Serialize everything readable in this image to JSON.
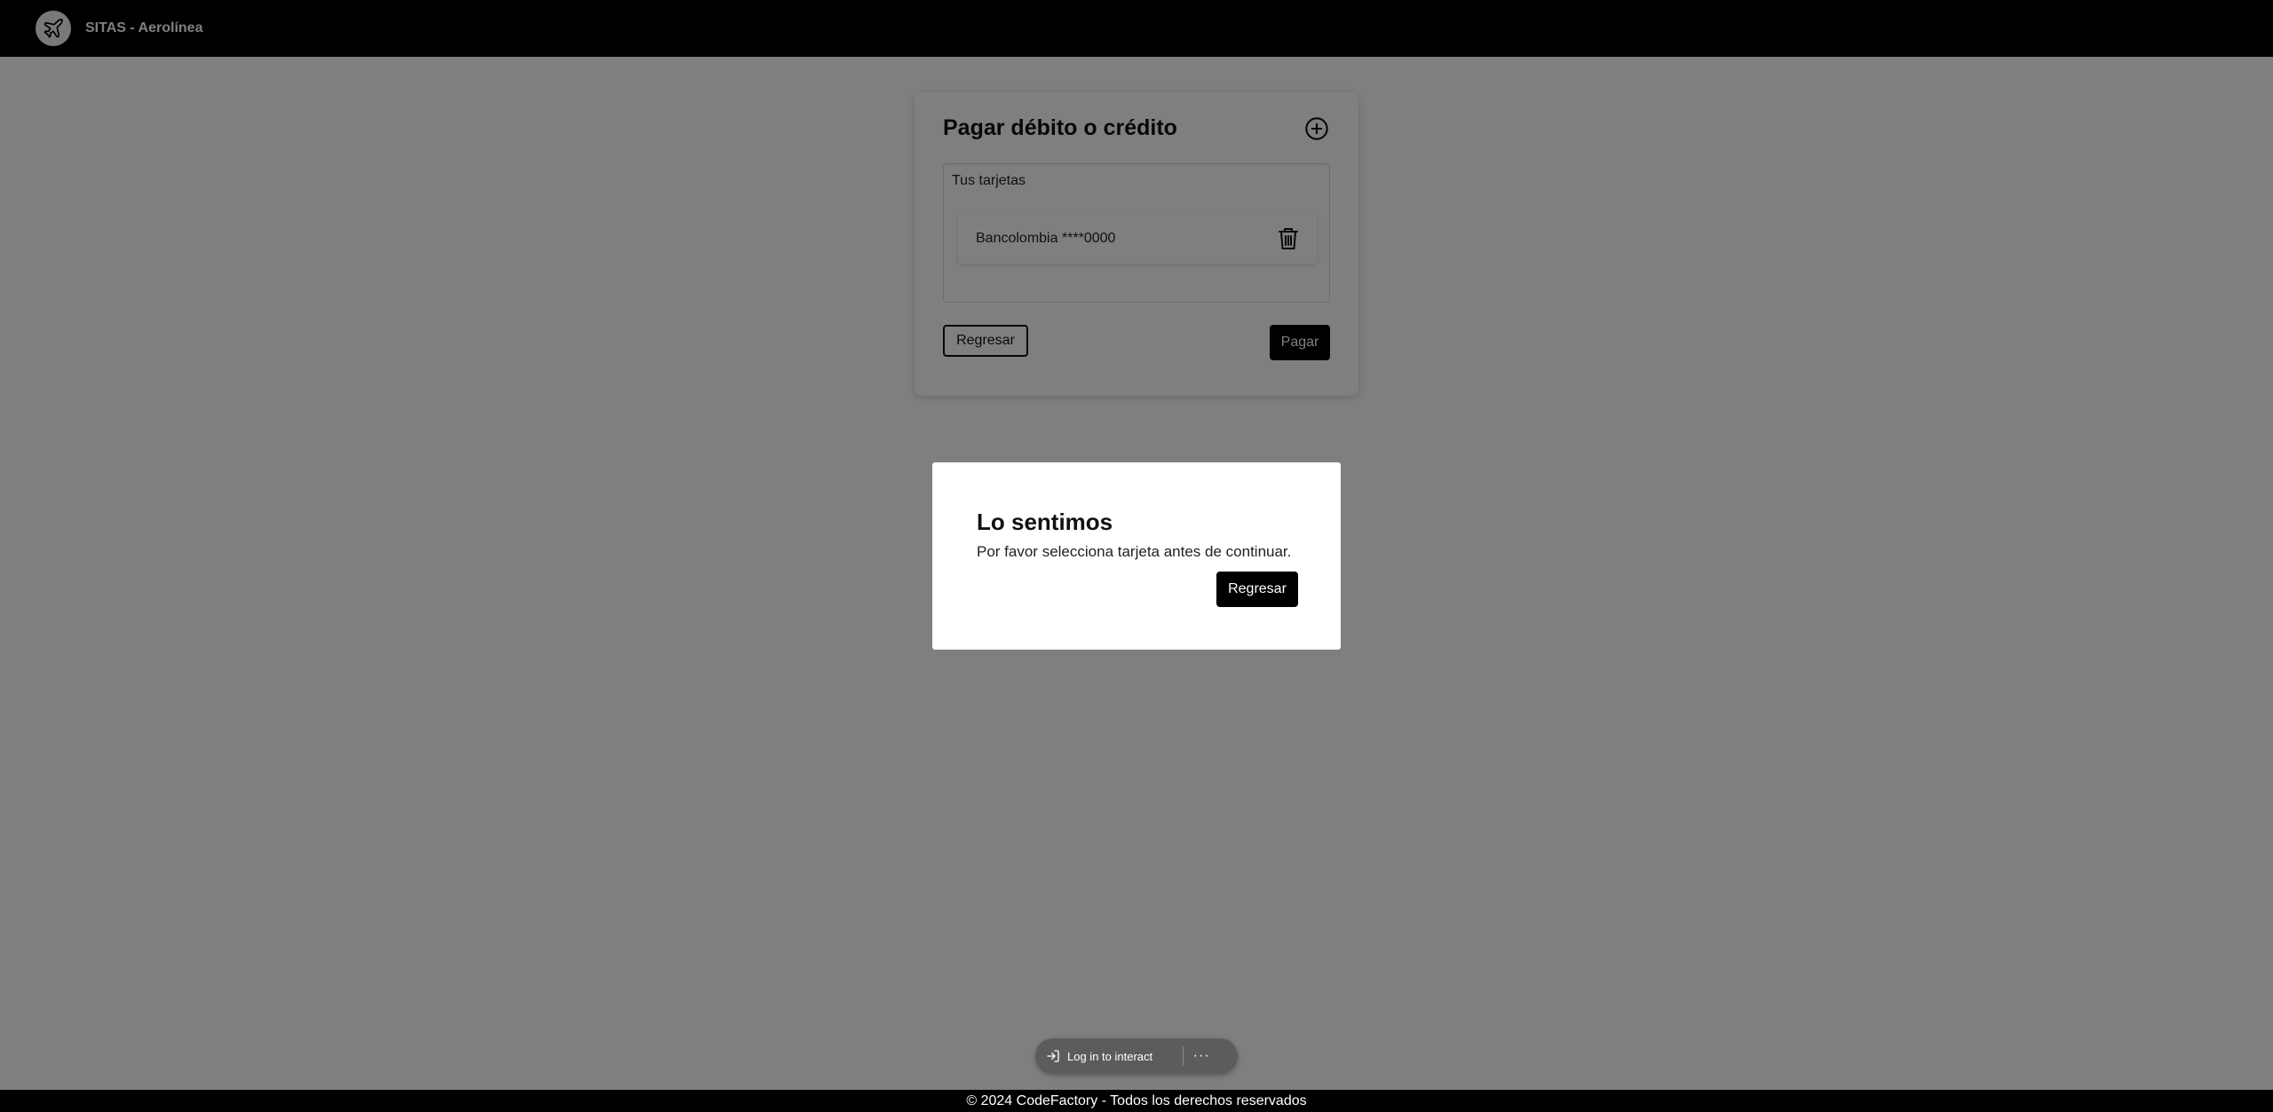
{
  "header": {
    "brand": "SITAS - Aerolínea"
  },
  "payment": {
    "title": "Pagar débito o crédito",
    "cards_label": "Tus tarjetas",
    "cards": [
      {
        "label": "Bancolombia ****0000"
      }
    ],
    "back_label": "Regresar",
    "pay_label": "Pagar"
  },
  "modal": {
    "title": "Lo sentimos",
    "message": "Por favor selecciona tarjeta antes de continuar.",
    "button_label": "Regresar"
  },
  "floating_bar": {
    "login_label": "Log in to interact",
    "more_label": "···"
  },
  "footer": {
    "text": "© 2024 CodeFactory - Todos los derechos reservados"
  },
  "colors": {
    "header_bg": "#000000",
    "overlay": "rgba(0,0,0,0.5)",
    "primary_button": "#000000"
  },
  "icons": {
    "logo": "airplane-icon",
    "add": "plus-circle-icon",
    "delete": "trash-icon",
    "login": "login-icon",
    "more": "more-icon"
  }
}
